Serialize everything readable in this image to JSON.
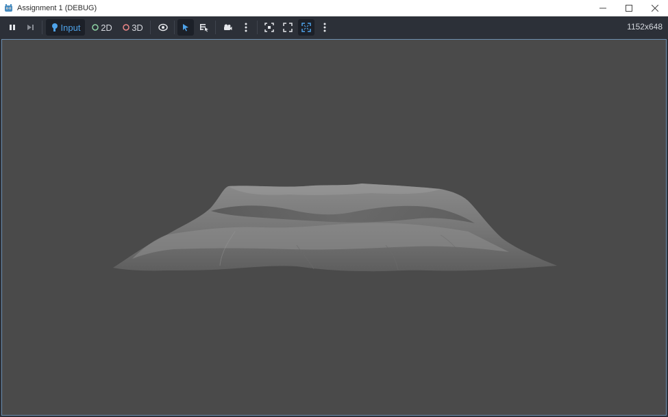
{
  "window": {
    "title": "Assignment 1 (DEBUG)",
    "app_icon": "godot-icon",
    "controls": [
      "minimize-icon",
      "maximize-icon",
      "close-icon"
    ]
  },
  "toolbar": {
    "pause_icon": "pause-icon",
    "next_frame_icon": "next-frame-icon",
    "input_label": "Input",
    "two_d_label": "2D",
    "three_d_label": "3D",
    "visibility_icon": "eye-icon",
    "select_icon": "select-arrow-icon",
    "list_select_icon": "list-select-icon",
    "camera_icon": "camera-icon",
    "more_icon": "vertical-ellipsis-icon",
    "frame_icon": "frame-selection-icon",
    "fullscreen_icon": "expand-icon",
    "embed_icon": "fit-window-icon",
    "resolution": "1152x648"
  },
  "colors": {
    "toolbar_bg": "#2c3038",
    "viewport_bg": "#4a4a4a",
    "accent_blue": "#4ea3ea",
    "two_d_color": "#8fd6a6",
    "three_d_color": "#f08888"
  }
}
